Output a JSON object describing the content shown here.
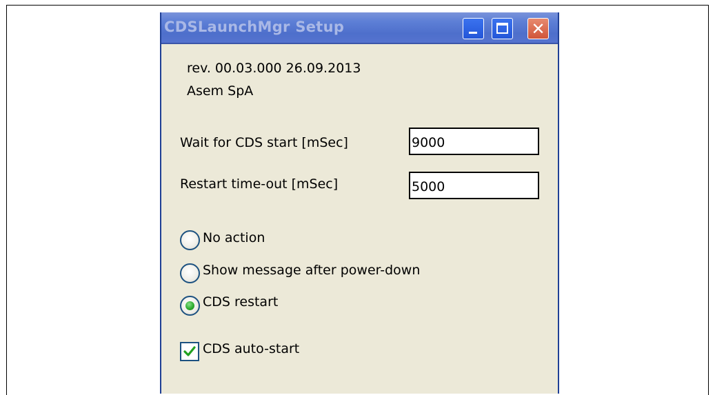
{
  "window": {
    "title": "CDSLaunchMgr Setup"
  },
  "info": {
    "revision": "rev. 00.03.000 26.09.2013",
    "company": "Asem SpA"
  },
  "fields": {
    "wait_label": "Wait for CDS start [mSec]",
    "wait_value": "9000",
    "restart_label": "Restart time-out [mSec]",
    "restart_value": "5000"
  },
  "options": {
    "no_action": "No action",
    "show_message": "Show message after power-down",
    "cds_restart": "CDS restart",
    "selected": "cds_restart"
  },
  "autostart": {
    "label": "CDS auto-start",
    "checked": true
  },
  "icons": {
    "minimize": "minimize-icon",
    "maximize": "maximize-icon",
    "close": "close-icon",
    "check": "checkmark-icon"
  },
  "colors": {
    "titlebar": "#5d7fd6",
    "dialog_bg": "#ece9d8",
    "radio_selected": "#2fae2f",
    "close_button": "#d0553a"
  }
}
